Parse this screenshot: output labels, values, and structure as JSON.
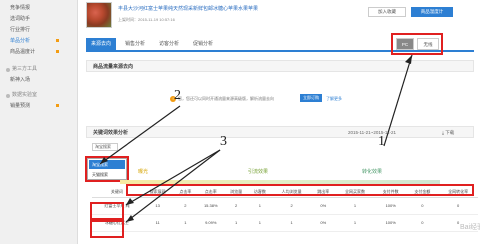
{
  "sidebar": {
    "items": [
      {
        "label": "竞争情报",
        "dot": false
      },
      {
        "label": "选词助手",
        "dot": false
      },
      {
        "label": "行业排行",
        "dot": false
      },
      {
        "label": "单品分析",
        "dot": true
      },
      {
        "label": "商品温度计",
        "dot": true
      }
    ],
    "section1": "第三方工具",
    "section1_items": [
      {
        "label": "新神入场"
      }
    ],
    "section2": "数据实验室",
    "section2_items": [
      {
        "label": "销量预测"
      }
    ]
  },
  "header": {
    "title": "丰县大沙河红富士苹果纯天然现采新鲜包邮冰糖心苹果水果苹果",
    "subinfo": "上架时间：2015-11-19 10:57:16",
    "fav_label": "加入收藏",
    "upload_label": "商品温度计"
  },
  "tabs": [
    {
      "label": "来源去向",
      "active": true
    },
    {
      "label": "销售分析",
      "active": false
    },
    {
      "label": "访客分析",
      "active": false
    },
    {
      "label": "促销分析",
      "active": false
    }
  ],
  "devices": {
    "pc": "PC",
    "wireless": "无线"
  },
  "section_title": "商品流量来源去向",
  "notice": {
    "icon": "!",
    "text": "您，您还可以同时开通流量来源高级版，解析流量去向",
    "button": "立即订购",
    "link": "了解更多"
  },
  "section2_title": "关键词效果分析",
  "date_range": "2015-11-21~2015-11-21",
  "download_label": "下载",
  "select_label": "淘宝搜索",
  "dropdown": [
    {
      "label": "淘宝搜索",
      "selected": true
    },
    {
      "label": "天猫搜索",
      "selected": false
    }
  ],
  "flow": [
    "曝光",
    "引流效果",
    "转化效果"
  ],
  "table": {
    "headers": [
      "关键词",
      "搜索展现",
      "点击率",
      "点击率",
      "浏览量",
      "访客数",
      "人均浏览量",
      "跳出率",
      "全网买家数",
      "支付件数",
      "支付金额",
      "全网转化率"
    ],
    "rows": [
      [
        "红富士苹果 纯",
        "13",
        "2",
        "15.38%",
        "2",
        "1",
        "2",
        "0%",
        "1",
        "100%",
        "0",
        "0"
      ],
      [
        "冰糖心红富士",
        "11",
        "1",
        "9.09%",
        "1",
        "1",
        "1",
        "0%",
        "1",
        "100%",
        "0",
        "0"
      ]
    ]
  },
  "annotations": [
    "1",
    "2",
    "3"
  ],
  "watermark": "Bai经验"
}
